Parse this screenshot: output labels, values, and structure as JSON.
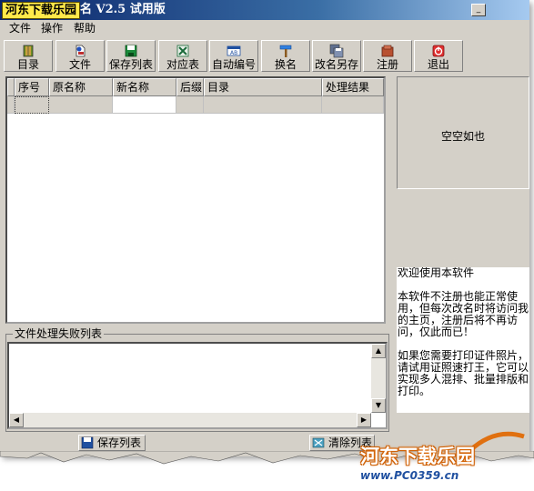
{
  "window": {
    "logo_text": "河东下载乐园",
    "title_rest": "名 V2.5 试用版",
    "minimize_glyph": "_"
  },
  "menu": [
    "文件",
    "操作",
    "帮助"
  ],
  "toolbar": [
    {
      "label": "目录",
      "icon": "folder-book-icon"
    },
    {
      "label": "文件",
      "icon": "file-icon"
    },
    {
      "label": "保存列表",
      "icon": "save-icon"
    },
    {
      "label": "对应表",
      "icon": "excel-icon"
    },
    {
      "label": "自动编号",
      "icon": "auto-number-icon"
    },
    {
      "label": "换名",
      "icon": "rename-hammer-icon"
    },
    {
      "label": "改名另存",
      "icon": "save-as-icon"
    },
    {
      "label": "注册",
      "icon": "register-icon"
    },
    {
      "label": "退出",
      "icon": "exit-icon"
    }
  ],
  "grid": {
    "columns": [
      "序号",
      "原名称",
      "新名称",
      "后缀",
      "目录",
      "处理结果"
    ]
  },
  "preview": {
    "empty_text": "空空如也"
  },
  "info": {
    "paragraphs": [
      "欢迎使用本软件",
      "本软件不注册也能正常使用，但每次改名时将访问我的主页，注册后将不再访问，仅此而已！",
      "如果您需要打印证件照片，请试用证照速打王，它可以实现多人混排、批量排版和打印。"
    ]
  },
  "fail_list": {
    "label": "文件处理失败列表"
  },
  "bottom_buttons": [
    {
      "label": "保存列表",
      "icon": "save-list-icon"
    },
    {
      "label": "清除列表",
      "icon": "clear-list-icon"
    }
  ],
  "watermark": {
    "title": "河东下载乐园",
    "url": "www.PC0359.cn"
  },
  "colors": {
    "title_gradient_start": "#0a246a",
    "face": "#d4d0c8",
    "logo_bg": "#ffe94a",
    "watermark_orange": "#e07010"
  }
}
